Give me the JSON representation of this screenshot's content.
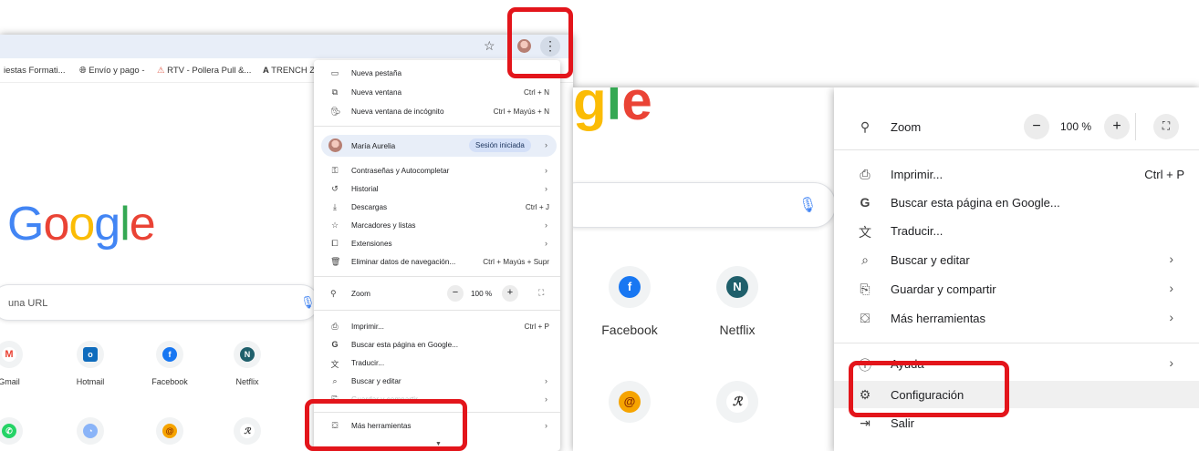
{
  "left": {
    "bookmarks": [
      {
        "label": "iestas Formati..."
      },
      {
        "label": "Envío y pago -"
      },
      {
        "label": "RTV - Pollera Pull &..."
      },
      {
        "label": "TRENCH ZI"
      }
    ],
    "search_placeholder": "una URL",
    "shortcuts": [
      {
        "label": "Gmail",
        "letter": "M"
      },
      {
        "label": "Hotmail",
        "letter": "o"
      },
      {
        "label": "Facebook",
        "letter": "f"
      },
      {
        "label": "Netflix",
        "letter": "N"
      }
    ],
    "menu": {
      "items_top": [
        {
          "label": "Nueva pestaña",
          "shortcut": ""
        },
        {
          "label": "Nueva ventana",
          "shortcut": "Ctrl + N"
        },
        {
          "label": "Nueva ventana de incógnito",
          "shortcut": "Ctrl + Mayús + N"
        }
      ],
      "profile": {
        "name": "María Aurelia",
        "status": "Sesión iniciada"
      },
      "items_mid": [
        {
          "label": "Contraseñas y Autocompletar",
          "shortcut": ""
        },
        {
          "label": "Historial",
          "shortcut": ""
        },
        {
          "label": "Descargas",
          "shortcut": "Ctrl + J"
        },
        {
          "label": "Marcadores y listas",
          "shortcut": ""
        },
        {
          "label": "Extensiones",
          "shortcut": ""
        },
        {
          "label": "Eliminar datos de navegación...",
          "shortcut": "Ctrl + Mayús + Supr"
        }
      ],
      "zoom": {
        "label": "Zoom",
        "value": "100 %"
      },
      "items_bottom": [
        {
          "label": "Imprimir...",
          "shortcut": "Ctrl + P"
        },
        {
          "label": "Buscar esta página en Google...",
          "shortcut": ""
        },
        {
          "label": "Traducir...",
          "shortcut": ""
        },
        {
          "label": "Buscar y editar",
          "shortcut": ""
        },
        {
          "label": "Guardar y compartir",
          "shortcut": ""
        },
        {
          "label": "Más herramientas",
          "shortcut": ""
        }
      ]
    }
  },
  "right": {
    "shortcuts": [
      {
        "label": "Facebook",
        "letter": "f"
      },
      {
        "label": "Netflix",
        "letter": "N"
      }
    ],
    "menu": {
      "zoom": {
        "label": "Zoom",
        "value": "100 %"
      },
      "items": [
        {
          "label": "Imprimir...",
          "shortcut": "Ctrl + P"
        },
        {
          "label": "Buscar esta página en Google...",
          "shortcut": ""
        },
        {
          "label": "Traducir...",
          "shortcut": ""
        },
        {
          "label": "Buscar y editar",
          "shortcut": ""
        },
        {
          "label": "Guardar y compartir",
          "shortcut": ""
        },
        {
          "label": "Más herramientas",
          "shortcut": ""
        },
        {
          "label": "Ayuda",
          "shortcut": ""
        },
        {
          "label": "Configuración",
          "shortcut": ""
        },
        {
          "label": "Salir",
          "shortcut": ""
        }
      ]
    }
  },
  "google_logo": [
    "G",
    "o",
    "o",
    "g",
    "l",
    "e"
  ],
  "colors": {
    "highlight": "#e3151b",
    "google_blue": "#4285f4",
    "google_red": "#ea4335",
    "google_yellow": "#fbbc05",
    "google_green": "#34a853"
  }
}
